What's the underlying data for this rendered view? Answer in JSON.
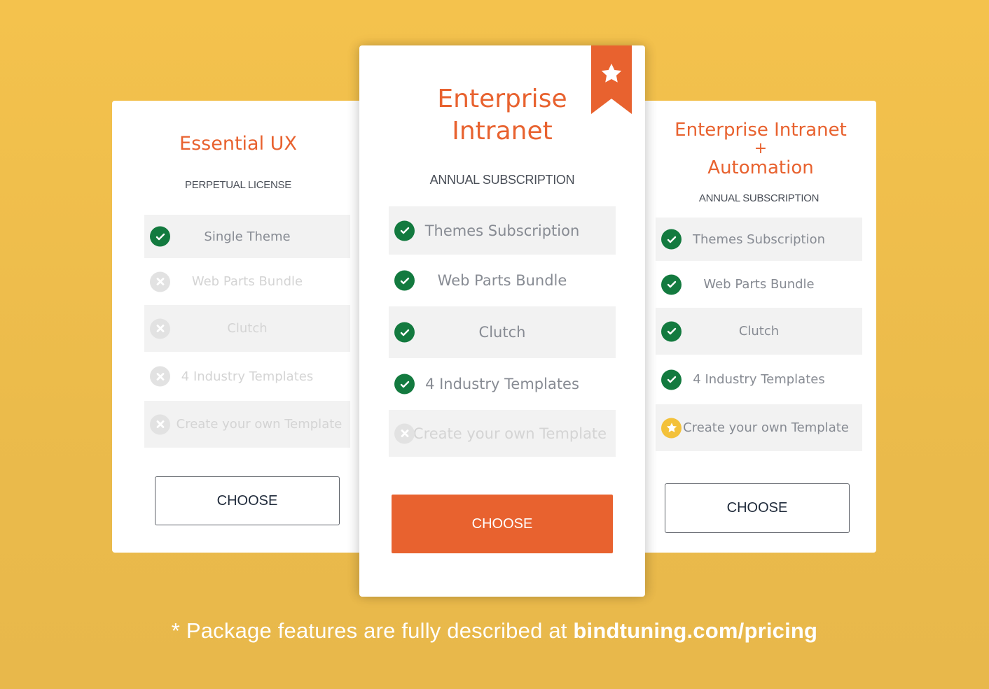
{
  "colors": {
    "background": "#f4c24d",
    "accent": "#e8622f",
    "check": "#137a3f",
    "star": "#f3c13a",
    "disabled": "#e2e2e2"
  },
  "plans": [
    {
      "title": "Essential UX",
      "license": "PERPETUAL LICENSE",
      "features": [
        {
          "label": "Single Theme",
          "status": "included",
          "icon": "check-circle-icon"
        },
        {
          "label": "Web Parts Bundle",
          "status": "excluded",
          "icon": "x-circle-icon"
        },
        {
          "label": "Clutch",
          "status": "excluded",
          "icon": "x-circle-icon"
        },
        {
          "label": "4 Industry Templates",
          "status": "excluded",
          "icon": "x-circle-icon"
        },
        {
          "label": "Create your own Template",
          "status": "excluded",
          "icon": "x-circle-icon"
        }
      ],
      "button_label": "CHOOSE"
    },
    {
      "title_line1": "Enterprise",
      "title_line2": "Intranet",
      "license": "ANNUAL SUBSCRIPTION",
      "badge_icon": "star-ribbon-icon",
      "features": [
        {
          "label": "Themes Subscription",
          "status": "included",
          "icon": "check-circle-icon"
        },
        {
          "label": "Web Parts Bundle",
          "status": "included",
          "icon": "check-circle-icon"
        },
        {
          "label": "Clutch",
          "status": "included",
          "icon": "check-circle-icon"
        },
        {
          "label": "4 Industry Templates",
          "status": "included",
          "icon": "check-circle-icon"
        },
        {
          "label": "Create your own Template",
          "status": "excluded",
          "icon": "x-circle-icon"
        }
      ],
      "button_label": "CHOOSE"
    },
    {
      "title_line1": "Enterprise Intranet",
      "title_plus": "+",
      "title_line2": "Automation",
      "license": "ANNUAL SUBSCRIPTION",
      "features": [
        {
          "label": "Themes Subscription",
          "status": "included",
          "icon": "check-circle-icon"
        },
        {
          "label": "Web Parts Bundle",
          "status": "included",
          "icon": "check-circle-icon"
        },
        {
          "label": "Clutch",
          "status": "included",
          "icon": "check-circle-icon"
        },
        {
          "label": "4 Industry Templates",
          "status": "included",
          "icon": "check-circle-icon"
        },
        {
          "label": "Create your own Template",
          "status": "premium",
          "icon": "star-circle-icon"
        }
      ],
      "button_label": "CHOOSE"
    }
  ],
  "footnote": {
    "prefix": "* Package features are fully described at ",
    "link": "bindtuning.com/pricing"
  }
}
